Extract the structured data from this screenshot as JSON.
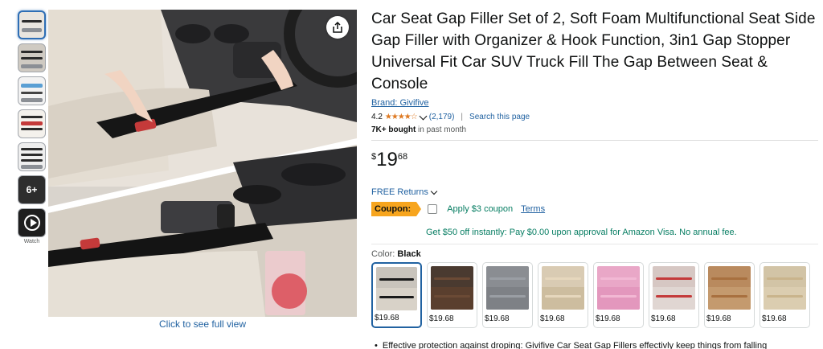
{
  "gallery": {
    "thumbnail_count": 7,
    "more_label": "6+",
    "watch_label": "Watch",
    "click_full_view": "Click to see full view"
  },
  "product": {
    "title": "Car Seat Gap Filler Set of 2, Soft Foam Multifunctional Seat Side Gap Filler with Organizer & Hook Function, 3in1 Gap Stopper Universal Fit Car SUV Truck Fill The Gap Between Seat & Console",
    "brand": "Brand: Givifive",
    "rating": "4.2",
    "stars": "★★★★☆",
    "rating_value": 4.2,
    "review_count": "(2,179)",
    "separator": "|",
    "search_page": "Search this page",
    "bought_bold": "7K+ bought",
    "bought_rest": " in past month"
  },
  "price": {
    "symbol": "$",
    "whole": "19",
    "fraction": "68"
  },
  "returns": {
    "label": "FREE Returns"
  },
  "coupon": {
    "tag": "Coupon:",
    "apply": "Apply $3 coupon",
    "terms": "Terms"
  },
  "visa": {
    "text": "Get $50 off instantly: Pay $0.00 upon approval for Amazon Visa. No annual fee."
  },
  "color": {
    "label": "Color: ",
    "selected": "Black",
    "options": [
      {
        "price": "$19.68",
        "base": "#c9c4bc",
        "filler": "#1a1a1a",
        "seat": "#d8d2c8"
      },
      {
        "price": "$19.68",
        "base": "#4a3a30",
        "filler": "#6b4a35",
        "seat": "#5a3f2e"
      },
      {
        "price": "$19.68",
        "base": "#8a8d92",
        "filler": "#9a9ea4",
        "seat": "#7e8186"
      },
      {
        "price": "$19.68",
        "base": "#d9cbb3",
        "filler": "#e6d7bd",
        "seat": "#cdbd9f"
      },
      {
        "price": "$19.68",
        "base": "#e9a7c7",
        "filler": "#f2b8d4",
        "seat": "#e397bd"
      },
      {
        "price": "$19.68",
        "base": "#d6c7c3",
        "filler": "#c43a3a",
        "seat": "#e0d6d2"
      },
      {
        "price": "$19.68",
        "base": "#b98a5e",
        "filler": "#a8703f",
        "seat": "#c49a6e"
      },
      {
        "price": "$19.68",
        "base": "#d2c4a6",
        "filler": "#c9b48c",
        "seat": "#dbcdb0"
      }
    ]
  },
  "bullet": {
    "text": "Effective protection against droping: Givifive Car Seat Gap Fillers effectivly keep things from falling"
  },
  "colors": {
    "link": "#2162a1",
    "coupon": "#f7a51e",
    "green": "#067d62",
    "star": "#de7921"
  }
}
